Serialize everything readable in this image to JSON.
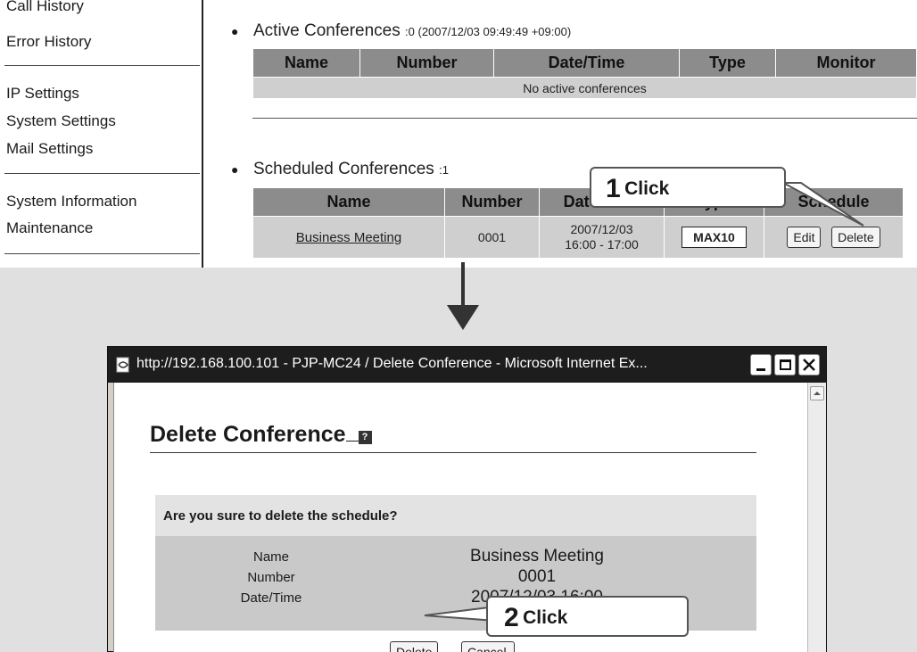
{
  "sidebar": {
    "items": [
      "Call History",
      "Error History",
      "IP Settings",
      "System Settings",
      "Mail Settings",
      "System Information",
      "Maintenance"
    ]
  },
  "active": {
    "title": "Active Conferences",
    "meta": ":0 (2007/12/03 09:49:49 +09:00)",
    "columns": [
      "Name",
      "Number",
      "Date/Time",
      "Type",
      "Monitor"
    ],
    "empty_text": "No active conferences"
  },
  "scheduled": {
    "title": "Scheduled Conferences",
    "meta": ":1",
    "columns": [
      "Name",
      "Number",
      "Date/Time",
      "Type",
      "Schedule"
    ],
    "row": {
      "name": "Business Meeting",
      "number": "0001",
      "datetime_line1": "2007/12/03",
      "datetime_line2": "16:00 - 17:00",
      "type": "MAX10",
      "edit_label": "Edit",
      "delete_label": "Delete"
    }
  },
  "callout1": {
    "number": "1",
    "text": "Click"
  },
  "callout2": {
    "number": "2",
    "text": "Click"
  },
  "dialog": {
    "window_title": "http://192.168.100.101 - PJP-MC24 / Delete Conference - Microsoft Internet Ex...",
    "heading": "Delete Conference",
    "confirm_text": "Are you sure to delete the schedule?",
    "fields": [
      {
        "label": "Name",
        "value": "Business Meeting"
      },
      {
        "label": "Number",
        "value": "0001"
      },
      {
        "label": "Date/Time",
        "value": "2007/12/03 16:00"
      }
    ],
    "delete_label": "Delete",
    "cancel_label": "Cancel"
  }
}
